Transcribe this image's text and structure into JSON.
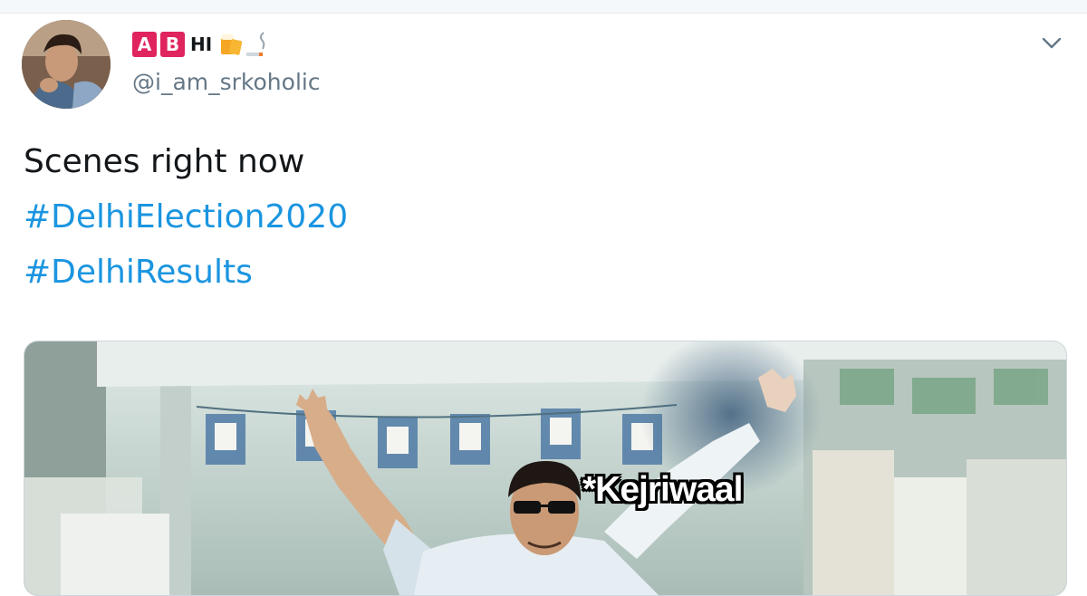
{
  "author": {
    "name_badge_letters": [
      "A",
      "B"
    ],
    "name_rest": "HI",
    "handle": "@i_am_srkoholic",
    "name_emoji_icons": [
      "beer-mugs-icon",
      "cigarette-icon"
    ]
  },
  "tweet": {
    "lines": [
      {
        "text": "Scenes right now",
        "type": "text"
      },
      {
        "text": "#DelhiElection2020",
        "type": "hashtag"
      },
      {
        "text": "#DelhiResults",
        "type": "hashtag"
      }
    ]
  },
  "media": {
    "caption": "*Kejriwaal"
  },
  "colors": {
    "hashtag": "#1b95e0",
    "badge": "#e0245e",
    "handle": "#657786",
    "text": "#14171a"
  },
  "icons": {
    "more": "chevron-down-icon"
  }
}
